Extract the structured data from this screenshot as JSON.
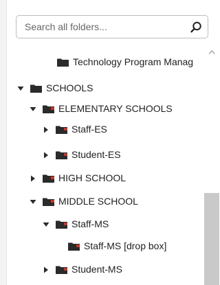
{
  "search": {
    "placeholder": "Search all folders...",
    "value": ""
  },
  "tree": {
    "items": [
      {
        "label": "Technology Program Manag",
        "icon": "folder-icon",
        "expander": "none"
      },
      {
        "label": "SCHOOLS",
        "icon": "folder-icon",
        "expander": "expanded"
      },
      {
        "label": "ELEMENTARY SCHOOLS",
        "icon": "folder-shared-icon",
        "expander": "expanded"
      },
      {
        "label": "Staff-ES",
        "icon": "folder-shared-icon",
        "expander": "collapsed"
      },
      {
        "label": "Student-ES",
        "icon": "folder-shared-icon",
        "expander": "collapsed"
      },
      {
        "label": "HIGH SCHOOL",
        "icon": "folder-shared-icon",
        "expander": "collapsed"
      },
      {
        "label": "MIDDLE SCHOOL",
        "icon": "folder-shared-icon",
        "expander": "expanded"
      },
      {
        "label": "Staff-MS",
        "icon": "folder-shared-icon",
        "expander": "expanded"
      },
      {
        "label": "Staff-MS [drop box]",
        "icon": "folder-shared-icon",
        "expander": "none"
      },
      {
        "label": "Student-MS",
        "icon": "folder-shared-icon",
        "expander": "collapsed"
      }
    ]
  },
  "colors": {
    "folder": "#2b2b2b",
    "shared_accent": "#c0392b",
    "scroll_thumb": "#c9c9c9"
  }
}
